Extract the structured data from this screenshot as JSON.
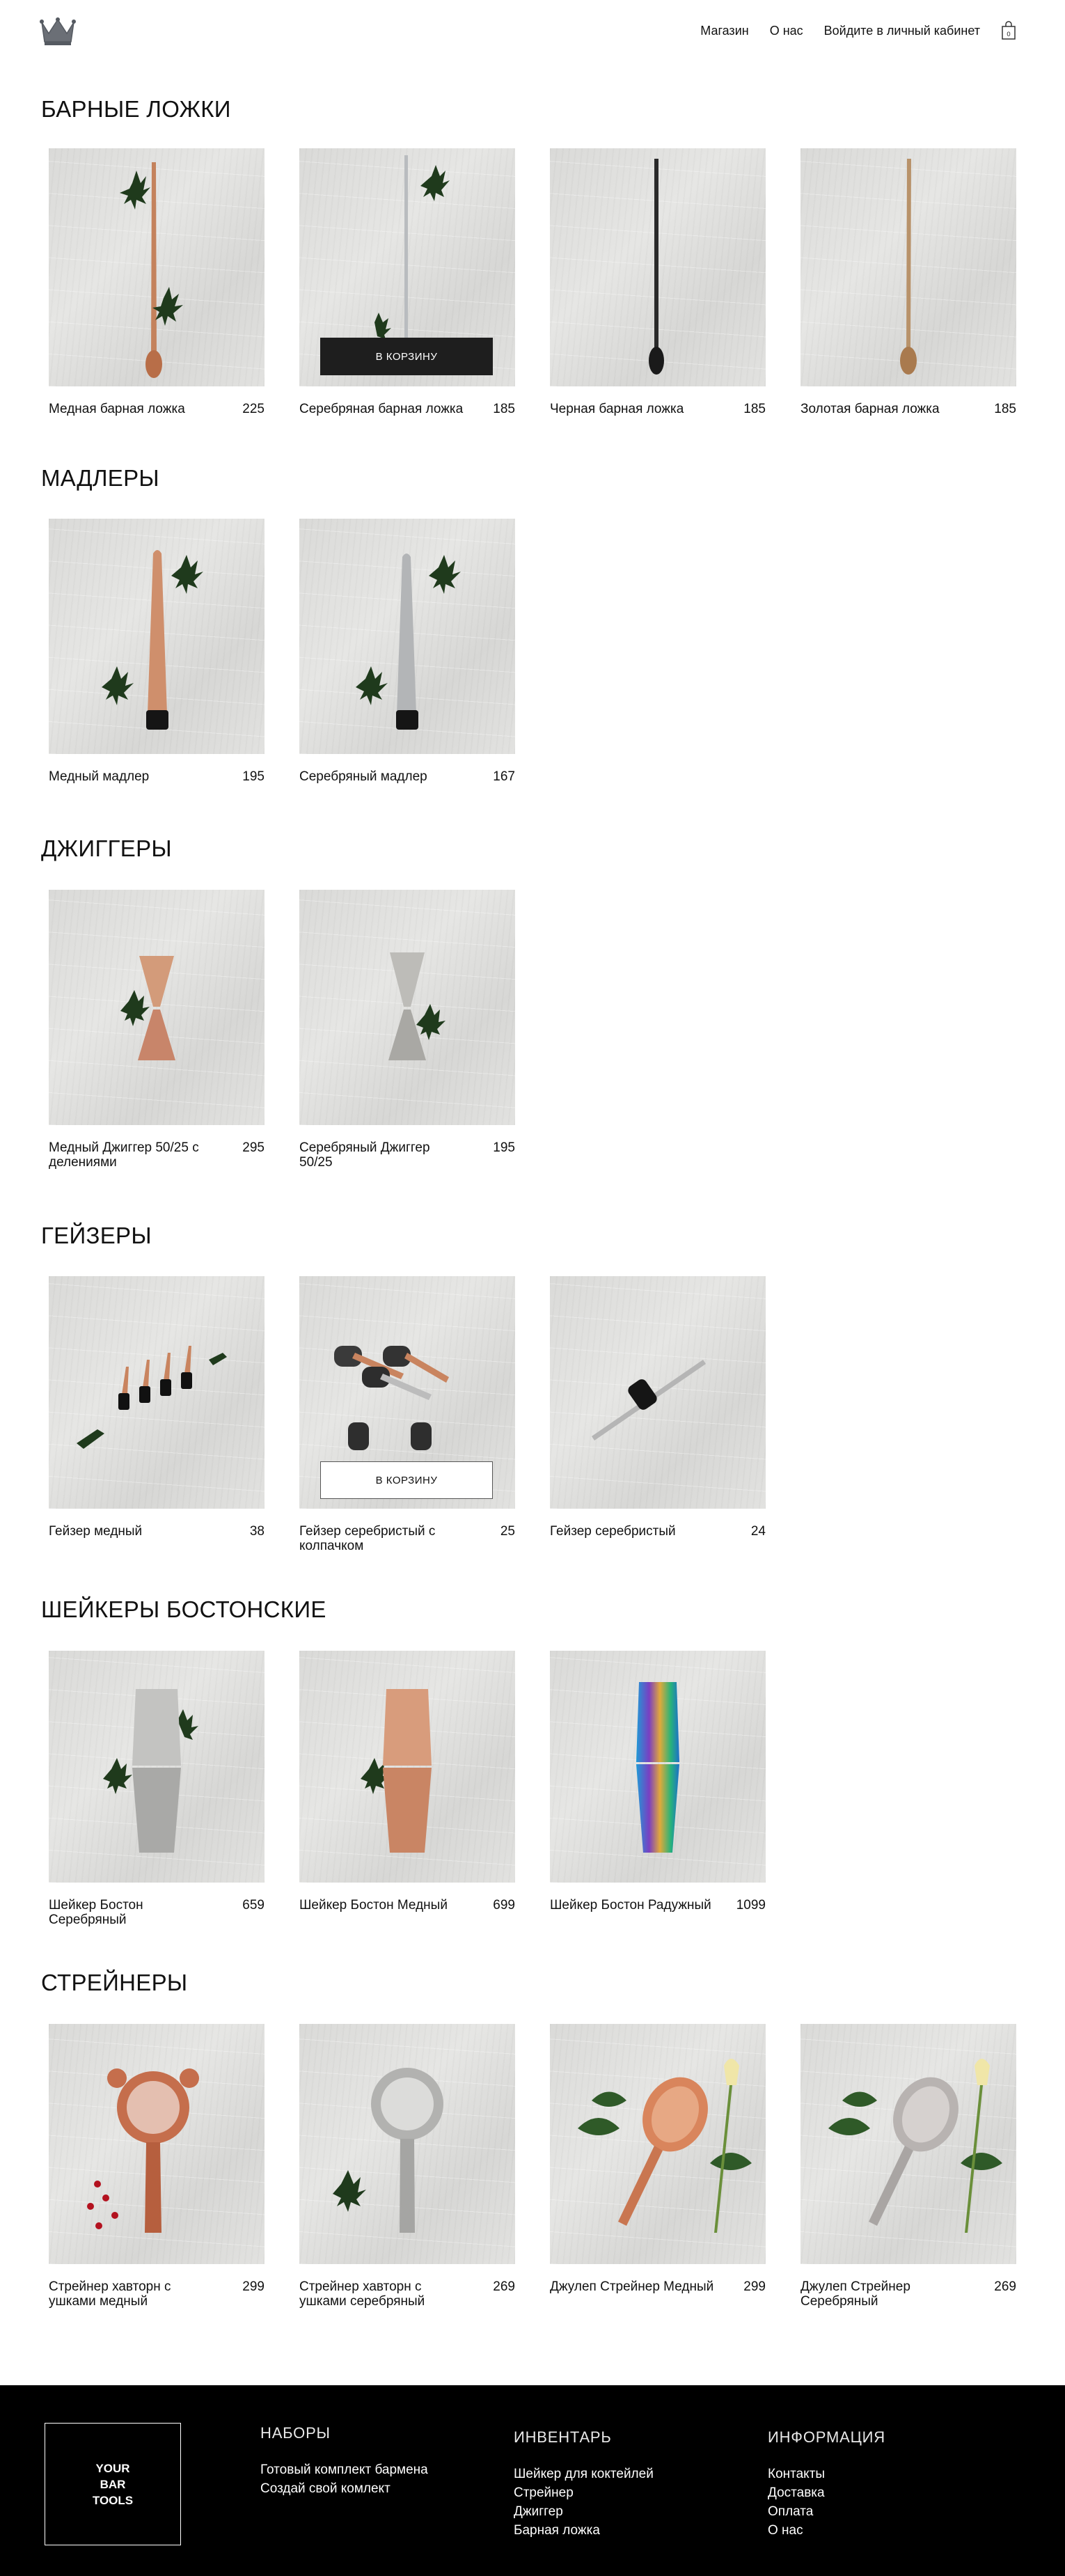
{
  "header": {
    "nav": [
      "Магазин",
      "О нас",
      "Войдите в личный кабинет"
    ]
  },
  "sections": [
    {
      "title": "БАРНЫЕ ЛОЖКИ",
      "products": [
        {
          "name": "Медная барная ложка",
          "price": "225"
        },
        {
          "name": "Серебряная барная ложка",
          "price": "185",
          "button": "В КОРЗИНУ"
        },
        {
          "name": "Черная барная ложка",
          "price": "185"
        },
        {
          "name": "Золотая барная ложка",
          "price": "185"
        }
      ]
    },
    {
      "title": "МАДЛЕРЫ",
      "products": [
        {
          "name": "Медный мадлер",
          "price": "195"
        },
        {
          "name": "Серебряный мадлер",
          "price": "167"
        }
      ]
    },
    {
      "title": "ДЖИГГЕРЫ",
      "products": [
        {
          "name": "Медный Джиггер 50/25 с делениями",
          "price": "295"
        },
        {
          "name": "Серебряный Джиггер 50/25",
          "price": "195"
        }
      ]
    },
    {
      "title": "ГЕЙЗЕРЫ",
      "products": [
        {
          "name": "Гейзер медный",
          "price": "38"
        },
        {
          "name": "Гейзер серебристый с колпачком",
          "price": "25",
          "button": "В КОРЗИНУ"
        },
        {
          "name": "Гейзер серебристый",
          "price": "24"
        }
      ]
    },
    {
      "title": "ШЕЙКЕРЫ БОСТОНСКИЕ",
      "products": [
        {
          "name": "Шейкер Бостон Серебряный",
          "price": "659"
        },
        {
          "name": "Шейкер Бостон Медный",
          "price": "699"
        },
        {
          "name": "Шейкер Бостон Радужный",
          "price": "1099"
        }
      ]
    },
    {
      "title": "СТРЕЙНЕРЫ",
      "products": [
        {
          "name": "Стрейнер хавторн с ушками медный",
          "price": "299"
        },
        {
          "name": "Стрейнер хавторн с ушками серебряный",
          "price": "269"
        },
        {
          "name": "Джулеп Стрейнер Медный",
          "price": "299"
        },
        {
          "name": "Джулеп Стрейнер Серебряный",
          "price": "269"
        }
      ]
    }
  ],
  "footer": {
    "logo_lines": [
      "YOUR",
      "BAR",
      "TOOLS"
    ],
    "columns": [
      {
        "title": "НАБОРЫ",
        "links": [
          "Готовый комплект бармена",
          "Создай свой комлект"
        ]
      },
      {
        "title": "ИНВЕНТАРЬ",
        "links": [
          "Шейкер для коктейлей",
          "Стрейнер",
          "Джиггер",
          "Барная ложка"
        ]
      },
      {
        "title": "ИНФОРМАЦИЯ",
        "links": [
          "Контакты",
          "Доставка",
          "Оплата",
          "О нас"
        ]
      }
    ]
  },
  "icons": {
    "logo": "crown-icon",
    "cart": "shopping-bag-icon"
  }
}
